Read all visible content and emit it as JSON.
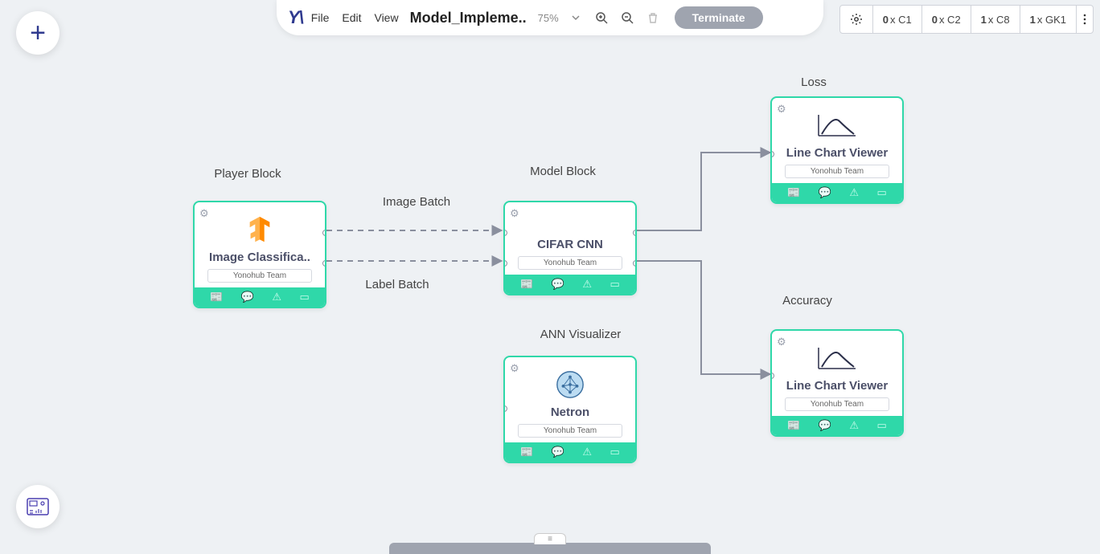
{
  "topbar": {
    "menu": {
      "file": "File",
      "edit": "Edit",
      "view": "View"
    },
    "title": "Model_Impleme..",
    "zoom": "75%",
    "terminate": "Terminate"
  },
  "resources": [
    {
      "count": "0",
      "label": " x C1"
    },
    {
      "count": "0",
      "label": " x C2"
    },
    {
      "count": "1",
      "label": " x C8"
    },
    {
      "count": "1",
      "label": " x GK1"
    }
  ],
  "labels": {
    "player": "Player Block",
    "model": "Model Block",
    "imageBatch": "Image Batch",
    "labelBatch": "Label Batch",
    "annViz": "ANN Visualizer",
    "loss": "Loss",
    "accuracy": "Accuracy"
  },
  "nodes": {
    "player": {
      "name": "Image Classifica..",
      "team": "Yonohub Team",
      "icon": "tensorflow"
    },
    "model": {
      "name": "CIFAR CNN",
      "team": "Yonohub Team",
      "icon": "none"
    },
    "netron": {
      "name": "Netron",
      "team": "Yonohub Team",
      "icon": "netron"
    },
    "loss": {
      "name": "Line Chart Viewer",
      "team": "Yonohub Team",
      "icon": "linechart"
    },
    "accuracy": {
      "name": "Line Chart Viewer",
      "team": "Yonohub Team",
      "icon": "linechart"
    }
  }
}
